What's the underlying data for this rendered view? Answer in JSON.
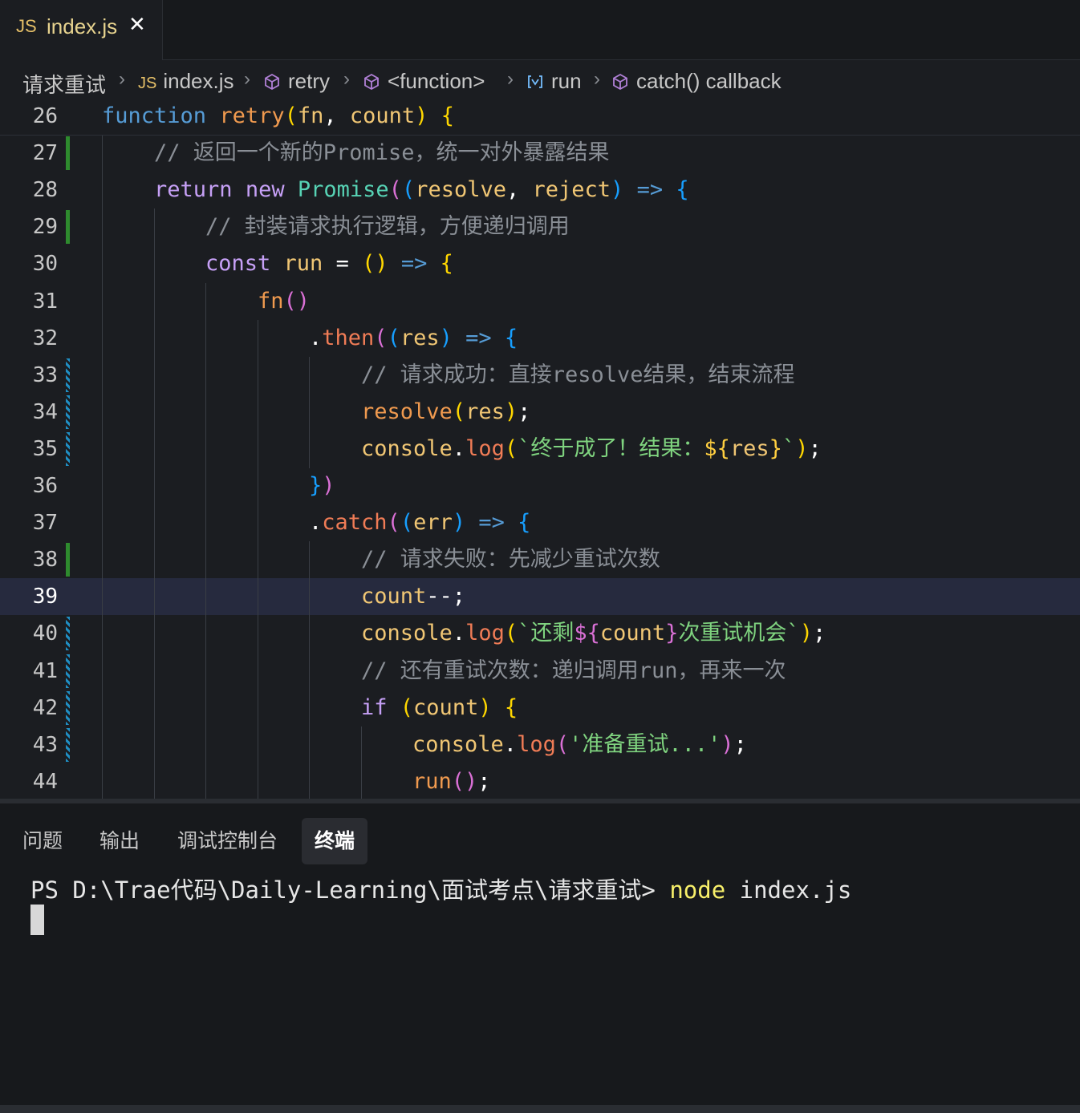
{
  "tab": {
    "icon": "JS",
    "name": "index.js",
    "close": "✕"
  },
  "breadcrumbs": [
    {
      "label": "请求重试",
      "icon": ""
    },
    {
      "label": "index.js",
      "icon": "JS"
    },
    {
      "label": "retry",
      "icon": "cube-icon"
    },
    {
      "label": "<function>",
      "icon": "cube-icon"
    },
    {
      "label": "run",
      "icon": "variable-icon"
    },
    {
      "label": "catch() callback",
      "icon": "cube-icon"
    }
  ],
  "editor": {
    "current_line": 39,
    "lines": [
      {
        "num": 26,
        "indent": 0,
        "gutter": "",
        "tokens": [
          [
            "kw",
            "function"
          ],
          [
            "op",
            " "
          ],
          [
            "fn",
            "retry"
          ],
          [
            "b1",
            "("
          ],
          [
            "prm",
            "fn"
          ],
          [
            "op",
            ", "
          ],
          [
            "prm",
            "count"
          ],
          [
            "b1",
            ")"
          ],
          [
            "op",
            " "
          ],
          [
            "b1",
            "{"
          ]
        ]
      },
      {
        "num": 27,
        "indent": 1,
        "gutter": "add",
        "tokens": [
          [
            "cm",
            "// 返回一个新的Promise，统一对外暴露结果"
          ]
        ]
      },
      {
        "num": 28,
        "indent": 1,
        "gutter": "",
        "tokens": [
          [
            "kw2",
            "return"
          ],
          [
            "op",
            " "
          ],
          [
            "kw2",
            "new"
          ],
          [
            "op",
            " "
          ],
          [
            "cls",
            "Promise"
          ],
          [
            "b2",
            "("
          ],
          [
            "b3",
            "("
          ],
          [
            "prm",
            "resolve"
          ],
          [
            "op",
            ", "
          ],
          [
            "prm",
            "reject"
          ],
          [
            "b3",
            ")"
          ],
          [
            "op",
            " "
          ],
          [
            "kw",
            "=>"
          ],
          [
            "op",
            " "
          ],
          [
            "b3",
            "{"
          ]
        ]
      },
      {
        "num": 29,
        "indent": 2,
        "gutter": "add",
        "tokens": [
          [
            "cm",
            "// 封装请求执行逻辑，方便递归调用"
          ]
        ]
      },
      {
        "num": 30,
        "indent": 2,
        "gutter": "",
        "tokens": [
          [
            "kw2",
            "const"
          ],
          [
            "op",
            " "
          ],
          [
            "var",
            "run"
          ],
          [
            "op",
            " = "
          ],
          [
            "b1",
            "()"
          ],
          [
            "op",
            " "
          ],
          [
            "kw",
            "=>"
          ],
          [
            "op",
            " "
          ],
          [
            "b1",
            "{"
          ]
        ]
      },
      {
        "num": 31,
        "indent": 3,
        "gutter": "",
        "tokens": [
          [
            "fn",
            "fn"
          ],
          [
            "b2",
            "()"
          ]
        ]
      },
      {
        "num": 32,
        "indent": 4,
        "gutter": "",
        "tokens": [
          [
            "op",
            "."
          ],
          [
            "mt",
            "then"
          ],
          [
            "b2",
            "("
          ],
          [
            "b3",
            "("
          ],
          [
            "prm",
            "res"
          ],
          [
            "b3",
            ")"
          ],
          [
            "op",
            " "
          ],
          [
            "kw",
            "=>"
          ],
          [
            "op",
            " "
          ],
          [
            "b3",
            "{"
          ]
        ]
      },
      {
        "num": 33,
        "indent": 5,
        "gutter": "mod",
        "tokens": [
          [
            "cm",
            "// 请求成功：直接resolve结果，结束流程"
          ]
        ]
      },
      {
        "num": 34,
        "indent": 5,
        "gutter": "mod",
        "tokens": [
          [
            "fn",
            "resolve"
          ],
          [
            "b1",
            "("
          ],
          [
            "prm",
            "res"
          ],
          [
            "b1",
            ")"
          ],
          [
            "op",
            ";"
          ]
        ]
      },
      {
        "num": 35,
        "indent": 5,
        "gutter": "mod",
        "tokens": [
          [
            "var",
            "console"
          ],
          [
            "op",
            "."
          ],
          [
            "mt",
            "log"
          ],
          [
            "b1",
            "("
          ],
          [
            "str",
            "`终于成了！结果："
          ],
          [
            "tpl",
            "${"
          ],
          [
            "prm",
            "res"
          ],
          [
            "tpl",
            "}"
          ],
          [
            "str",
            "`"
          ],
          [
            "b1",
            ")"
          ],
          [
            "op",
            ";"
          ]
        ]
      },
      {
        "num": 36,
        "indent": 4,
        "gutter": "",
        "tokens": [
          [
            "b3",
            "}"
          ],
          [
            "b2",
            ")"
          ]
        ]
      },
      {
        "num": 37,
        "indent": 4,
        "gutter": "",
        "tokens": [
          [
            "op",
            "."
          ],
          [
            "mt",
            "catch"
          ],
          [
            "b2",
            "("
          ],
          [
            "b3",
            "("
          ],
          [
            "prm",
            "err"
          ],
          [
            "b3",
            ")"
          ],
          [
            "op",
            " "
          ],
          [
            "kw",
            "=>"
          ],
          [
            "op",
            " "
          ],
          [
            "b3",
            "{"
          ]
        ]
      },
      {
        "num": 38,
        "indent": 5,
        "gutter": "add",
        "tokens": [
          [
            "cm",
            "// 请求失败：先减少重试次数"
          ]
        ]
      },
      {
        "num": 39,
        "indent": 5,
        "gutter": "",
        "tokens": [
          [
            "var",
            "count"
          ],
          [
            "op",
            "--;"
          ]
        ]
      },
      {
        "num": 40,
        "indent": 5,
        "gutter": "mod",
        "tokens": [
          [
            "var",
            "console"
          ],
          [
            "op",
            "."
          ],
          [
            "mt",
            "log"
          ],
          [
            "b1",
            "("
          ],
          [
            "str",
            "`还剩"
          ],
          [
            "b2",
            "${"
          ],
          [
            "prm",
            "count"
          ],
          [
            "b2",
            "}"
          ],
          [
            "str",
            "次重试机会`"
          ],
          [
            "b1",
            ")"
          ],
          [
            "op",
            ";"
          ]
        ]
      },
      {
        "num": 41,
        "indent": 5,
        "gutter": "mod",
        "tokens": [
          [
            "cm",
            "// 还有重试次数：递归调用run，再来一次"
          ]
        ]
      },
      {
        "num": 42,
        "indent": 5,
        "gutter": "mod",
        "tokens": [
          [
            "kw2",
            "if"
          ],
          [
            "op",
            " "
          ],
          [
            "b1",
            "("
          ],
          [
            "prm",
            "count"
          ],
          [
            "b1",
            ")"
          ],
          [
            "op",
            " "
          ],
          [
            "b1",
            "{"
          ]
        ]
      },
      {
        "num": 43,
        "indent": 6,
        "gutter": "mod",
        "tokens": [
          [
            "var",
            "console"
          ],
          [
            "op",
            "."
          ],
          [
            "mt",
            "log"
          ],
          [
            "b2",
            "("
          ],
          [
            "str",
            "'准备重试...'"
          ],
          [
            "b2",
            ")"
          ],
          [
            "op",
            ";"
          ]
        ]
      },
      {
        "num": 44,
        "indent": 6,
        "gutter": "",
        "tokens": [
          [
            "fn",
            "run"
          ],
          [
            "b2",
            "()"
          ],
          [
            "op",
            ";"
          ]
        ]
      }
    ]
  },
  "panel": {
    "tabs": [
      "问题",
      "输出",
      "调试控制台",
      "终端"
    ],
    "active_tab": "终端",
    "terminal": {
      "prompt": "PS D:\\Trae代码\\Daily-Learning\\面试考点\\请求重试> ",
      "command": "node",
      "args": " index.js"
    }
  }
}
